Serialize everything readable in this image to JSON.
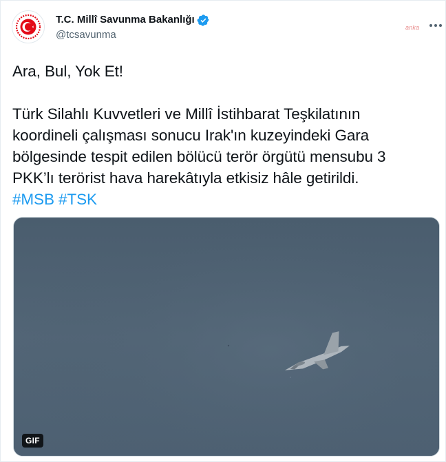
{
  "author": {
    "display_name": "T.C. Millî Savunma Bakanlığı",
    "handle": "@tcsavunma",
    "verified": true,
    "avatar_icon": "msb-emblem-icon"
  },
  "watermark": "anka",
  "tweet": {
    "line_headline": "Ara, Bul, Yok Et!",
    "body_lines": [
      "Türk Silahlı Kuvvetleri ve Millî İstihbarat Teşkilatının",
      "koordineli çalışması sonucu Irak'ın kuzeyindeki Gara",
      "bölgesinde tespit edilen bölücü terör örgütü mensubu 3",
      "PKK’lı terörist hava harekâtıyla etkisiz hâle getirildi."
    ],
    "hashtags": [
      "#MSB",
      "#TSK"
    ]
  },
  "media": {
    "type_badge": "GIF"
  },
  "colors": {
    "link": "#1d9bf0",
    "verified": "#1d9bf0",
    "text": "#0f1419",
    "secondary": "#536471",
    "emblem_red": "#e30a17",
    "sky": "#4f6273"
  },
  "icons": {
    "verified": "verified-badge-icon",
    "more": "more-dots-icon"
  }
}
